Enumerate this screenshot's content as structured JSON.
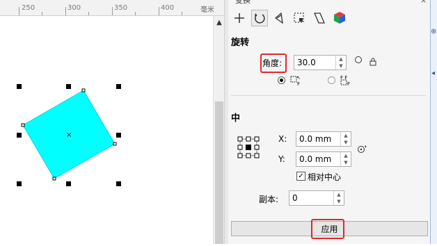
{
  "ruler": {
    "ticks": [
      "250",
      "300",
      "350",
      "400"
    ],
    "unit": "毫米"
  },
  "panel": {
    "title": "变换",
    "close_icon": "close-icon",
    "tools": [
      "position-icon",
      "rotate-icon",
      "scale-mirror-icon",
      "size-icon",
      "skew-icon",
      "color-cube-icon"
    ]
  },
  "rotate": {
    "section_title": "旋转",
    "angle_label": "角度:",
    "angle_value": "30.0"
  },
  "center": {
    "section_title": "中",
    "x_label": "X:",
    "x_value": "0.0 mm",
    "y_label": "Y:",
    "y_value": "0.0 mm",
    "relative_center_label": "相对中心",
    "relative_center_checked": true
  },
  "copies": {
    "label": "副本:",
    "value": "0"
  },
  "apply": {
    "label": "应用"
  },
  "colors": {
    "shape_fill": "#00ffff",
    "highlight": "#e0272a"
  }
}
